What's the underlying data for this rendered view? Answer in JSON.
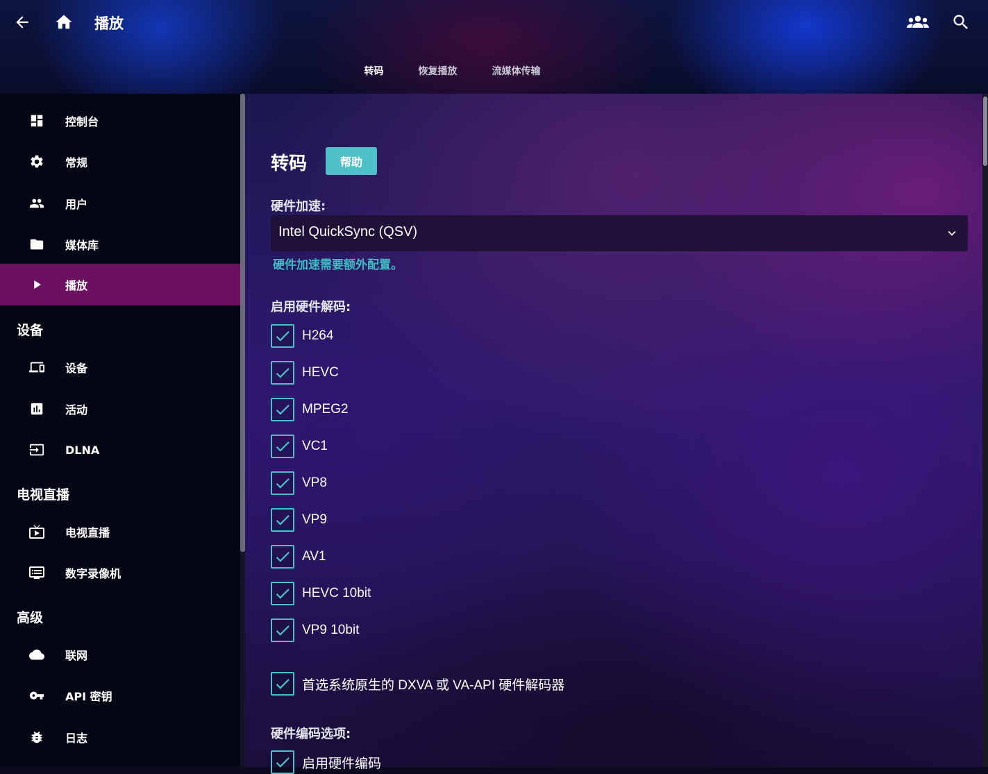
{
  "header": {
    "page_title": "播放",
    "tabs": [
      {
        "label": "转码",
        "active": true
      },
      {
        "label": "恢复播放",
        "active": false
      },
      {
        "label": "流媒体传输",
        "active": false
      }
    ],
    "icons": [
      "arrow-back-icon",
      "home-icon",
      "users-icon",
      "search-icon"
    ]
  },
  "sidebar": {
    "items_top": [
      {
        "label": "控制台",
        "icon": "dashboard-icon"
      },
      {
        "label": "常规",
        "icon": "gear-icon"
      },
      {
        "label": "用户",
        "icon": "people-icon"
      },
      {
        "label": "媒体库",
        "icon": "folder-icon"
      },
      {
        "label": "播放",
        "icon": "play-icon",
        "active": true
      }
    ],
    "section_devices": {
      "title": "设备",
      "items": [
        {
          "label": "设备",
          "icon": "devices-icon"
        },
        {
          "label": "活动",
          "icon": "chart-icon"
        },
        {
          "label": "DLNA",
          "icon": "input-icon"
        }
      ]
    },
    "section_livetv": {
      "title": "电视直播",
      "items": [
        {
          "label": "电视直播",
          "icon": "live-tv-icon"
        },
        {
          "label": "数字录像机",
          "icon": "dvr-icon"
        }
      ]
    },
    "section_advanced": {
      "title": "高级",
      "items": [
        {
          "label": "联网",
          "icon": "cloud-icon"
        },
        {
          "label": "API 密钥",
          "icon": "key-icon"
        },
        {
          "label": "日志",
          "icon": "bug-icon"
        }
      ]
    }
  },
  "main": {
    "title": "转码",
    "help_label": "帮助",
    "hw_accel_label": "硬件加速:",
    "hw_accel_value": "Intel QuickSync (QSV)",
    "hw_accel_hint": "硬件加速需要额外配置。",
    "hw_decode_label": "启用硬件解码:",
    "decoders": [
      {
        "label": "H264",
        "checked": true
      },
      {
        "label": "HEVC",
        "checked": true
      },
      {
        "label": "MPEG2",
        "checked": true
      },
      {
        "label": "VC1",
        "checked": true
      },
      {
        "label": "VP8",
        "checked": true
      },
      {
        "label": "VP9",
        "checked": true
      },
      {
        "label": "AV1",
        "checked": true
      },
      {
        "label": "HEVC 10bit",
        "checked": true
      },
      {
        "label": "VP9 10bit",
        "checked": true
      }
    ],
    "prefer_native": {
      "label": "首选系统原生的 DXVA 或 VA-API 硬件解码器",
      "checked": true
    },
    "hw_encode_label": "硬件编码选项:",
    "enable_hw_encode": {
      "label": "启用硬件编码",
      "checked": true
    }
  },
  "colors": {
    "accent": "#4ec1c8",
    "active_nav": "#6b1160",
    "sidebar_bg": "#050714"
  }
}
